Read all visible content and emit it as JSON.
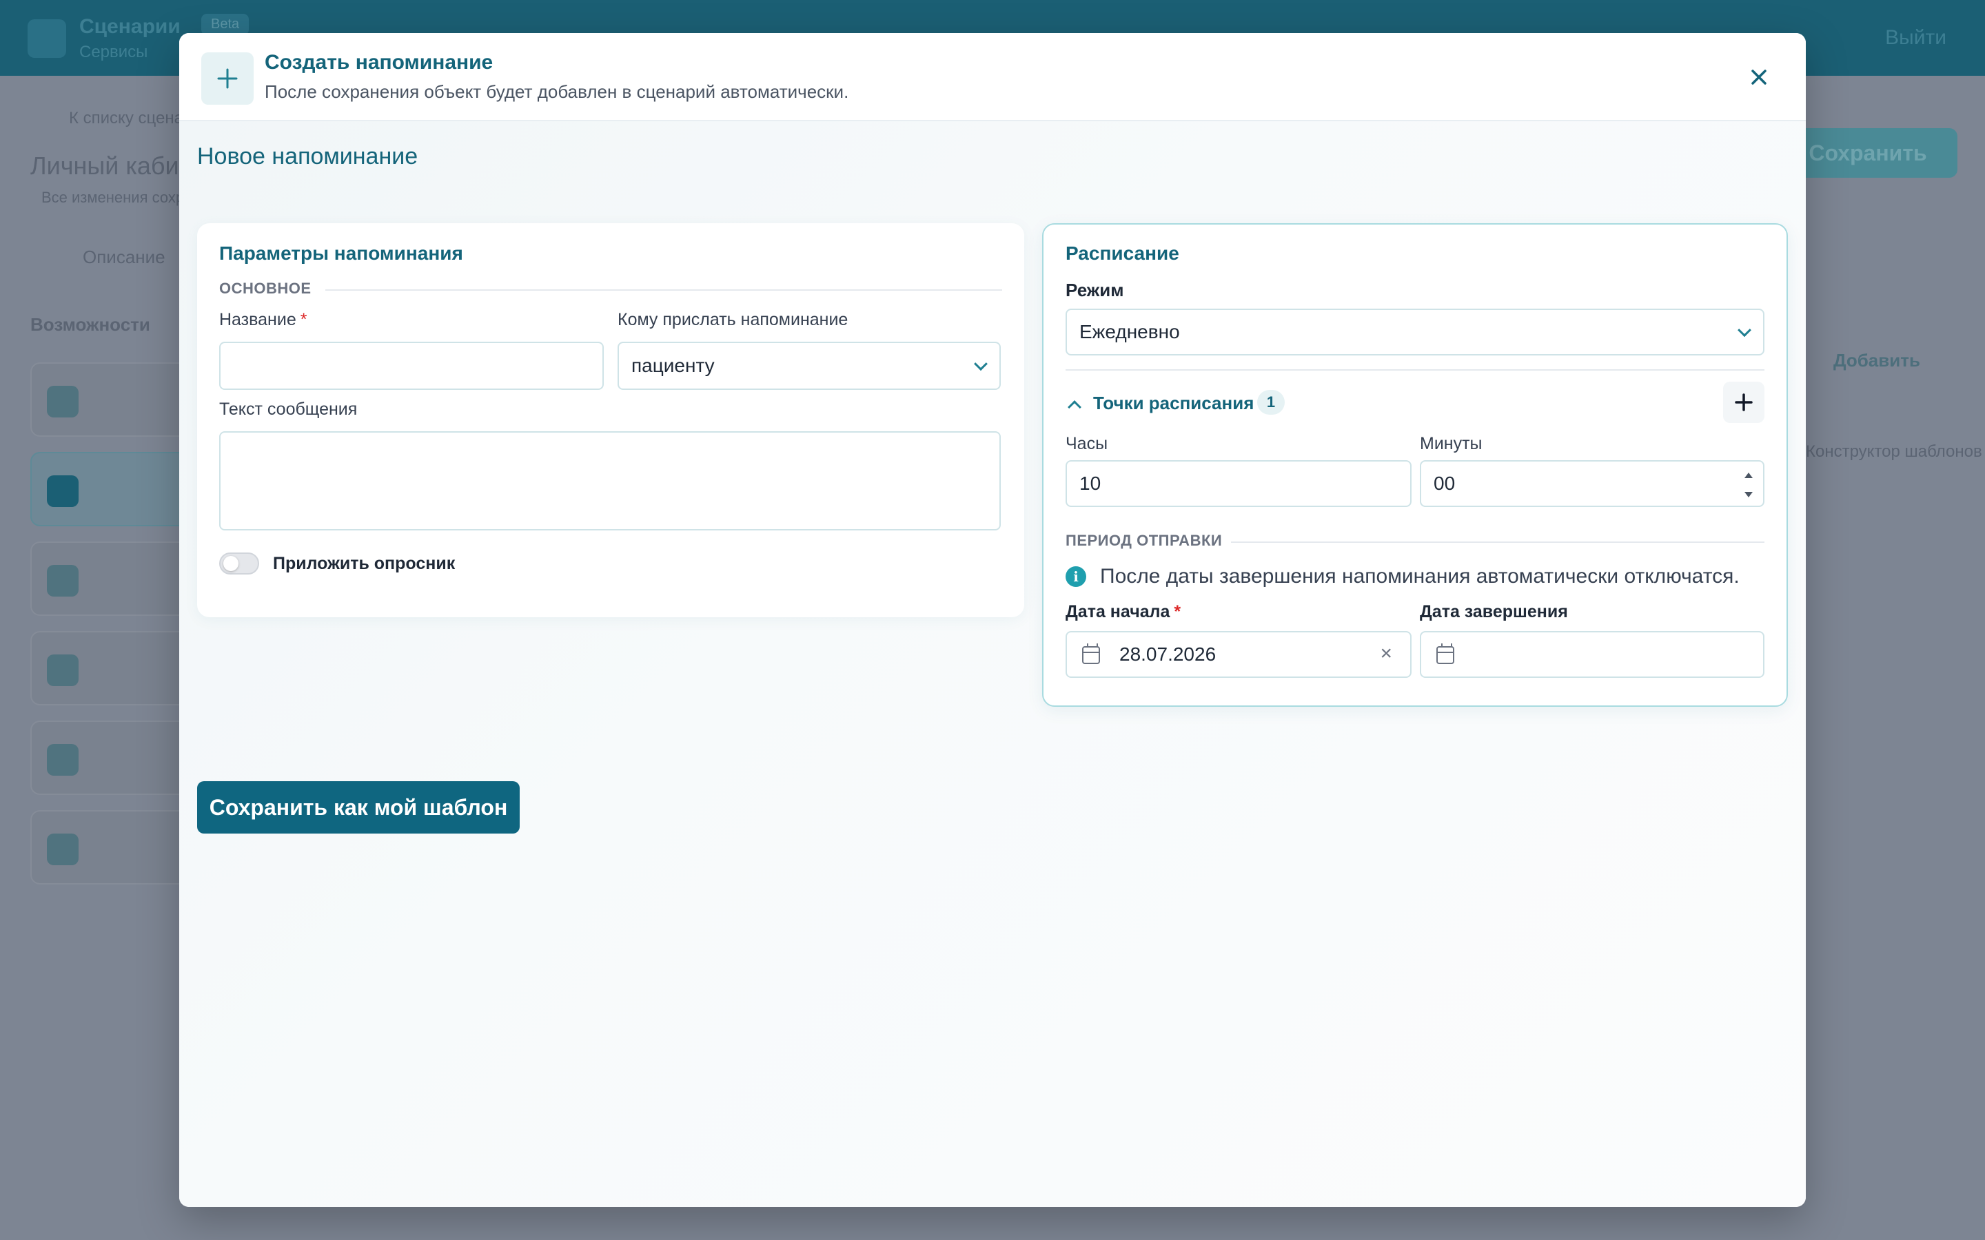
{
  "background": {
    "app_title": "Сценарии",
    "app_subtitle": "Сервисы",
    "badge": "Beta",
    "logout_label": "Выйти",
    "save_label": "Сохранить",
    "back_link": "К списку сценариев",
    "page_title": "Личный кабинет",
    "page_note": "Все изменения сохранены",
    "tab_label": "Описание",
    "section_title": "Возможности",
    "add_label": "Добавить",
    "template_label": "Конструктор шаблонов"
  },
  "modal": {
    "title": "Создать напоминание",
    "subtitle": "После сохранения объект будет добавлен в сценарий автоматически.",
    "heading": "Новое напоминание",
    "close_icon": "close-icon",
    "header_icon": "plus-icon"
  },
  "params": {
    "title": "Параметры напоминания",
    "section": "ОСНОВНОЕ",
    "name_label": "Название",
    "required_mark": "*",
    "name_value": "",
    "recipient_label": "Кому прислать напоминание",
    "recipient_value": "пациенту",
    "message_label": "Текст сообщения",
    "message_value": "",
    "attach_label": "Приложить опросник",
    "attach_on": false
  },
  "schedule": {
    "title": "Расписание",
    "mode_label": "Режим",
    "mode_value": "Ежедневно",
    "points_label": "Точки расписания",
    "points_count": "1",
    "hours_label": "Часы",
    "hours_value": "10",
    "minutes_label": "Минуты",
    "minutes_value": "00",
    "period_section": "ПЕРИОД ОТПРАВКИ",
    "info_text": "После даты завершения напоминания автоматически отключатся.",
    "start_label": "Дата начала",
    "start_value": "28.07.2026",
    "end_label": "Дата завершения",
    "end_value": ""
  },
  "actions": {
    "save_template": "Сохранить как мой шаблон"
  },
  "colors": {
    "primary": "#0f6680",
    "accent": "#14647a",
    "required": "#dc2626"
  }
}
